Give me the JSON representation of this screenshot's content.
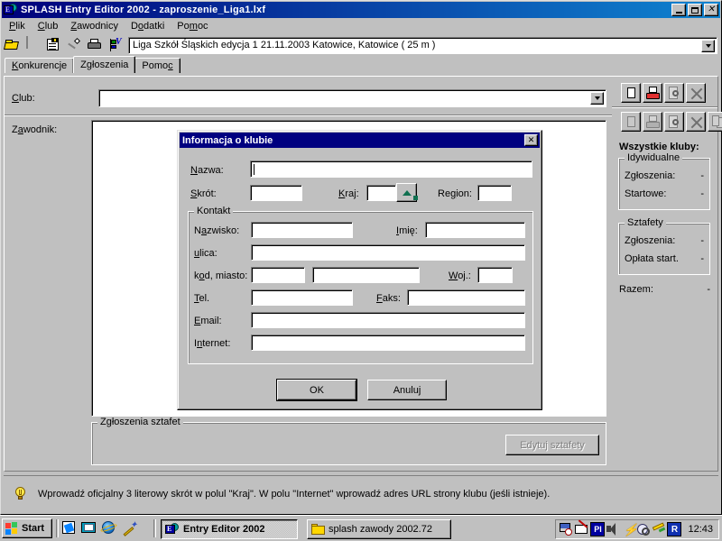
{
  "window": {
    "title": "SPLASH Entry Editor 2002 - zaproszenie_Liga1.lxf",
    "app_icon": "splash-app-icon",
    "minimize": "_",
    "maximize": "□",
    "close": "✕"
  },
  "menu": {
    "items": [
      {
        "label": "Plik",
        "accel": "P"
      },
      {
        "label": "Club",
        "accel": "C"
      },
      {
        "label": "Zawodnicy",
        "accel": "Z"
      },
      {
        "label": "Dodatki",
        "accel": "o"
      },
      {
        "label": "Pomoc",
        "accel": "m"
      }
    ]
  },
  "toolbar": {
    "buttons": [
      {
        "name": "open-icon",
        "title": "Otwórz"
      },
      {
        "name": "save-icon",
        "title": "Zapisz"
      },
      {
        "name": "properties-icon",
        "title": "Właściwości"
      },
      {
        "name": "pin-icon",
        "title": "Przypnij"
      },
      {
        "name": "print-icon",
        "title": "Drukuj"
      },
      {
        "name": "verify-flag-icon",
        "title": "Weryfikacja"
      }
    ],
    "meet_combo": {
      "value": "Liga Szkół Śląskich edycja 1      21.11.2003 Katowice,  Katowice   ( 25 m )",
      "arrow": "chevron-down-icon"
    }
  },
  "tabs": [
    {
      "label": "Konkurencje",
      "accel": "K",
      "active": false
    },
    {
      "label": "Zgłoszenia",
      "accel": "g",
      "active": true
    },
    {
      "label": "Pomoc",
      "accel": "c",
      "active": false
    }
  ],
  "main": {
    "club_label": "Club:",
    "club_accel": "C",
    "club_value": "",
    "zawodnik_label": "Zawodnik:",
    "zawodnik_accel": "a",
    "relay_group_title": "Zgłoszenia sztafet",
    "edit_relay_button": "Edytuj sztafety",
    "edit_relay_accel": "d"
  },
  "side_panel": {
    "row1_buttons": [
      {
        "name": "new-entry-icon",
        "enabled": true
      },
      {
        "name": "print-entry-icon",
        "enabled": true
      },
      {
        "name": "preview-entry-icon",
        "enabled": false
      },
      {
        "name": "delete-entry-icon",
        "enabled": true
      }
    ],
    "row2_buttons": [
      {
        "name": "new-athlete-icon",
        "enabled": false
      },
      {
        "name": "print-athlete-icon",
        "enabled": false
      },
      {
        "name": "preview-athlete-icon",
        "enabled": false
      },
      {
        "name": "delete-athlete-icon",
        "enabled": false
      },
      {
        "name": "copy-athlete-icon",
        "enabled": false
      }
    ],
    "title": "Wszystkie kluby:",
    "individual": {
      "title": "Idywidualne",
      "rows": [
        {
          "label": "Zgłoszenia:",
          "value": "-"
        },
        {
          "label": "Startowe:",
          "value": "-"
        }
      ]
    },
    "relays": {
      "title": "Sztafety",
      "rows": [
        {
          "label": "Zgłoszenia:",
          "value": "-"
        },
        {
          "label": "Opłata start.",
          "value": "-"
        }
      ]
    },
    "total": {
      "label": "Razem:",
      "value": "-"
    }
  },
  "hint_bar": {
    "icon": "lightbulb-icon",
    "text": "Wprowadź oficjalny 3 literowy skrót w polul \"Kraj\". W polu \"Internet\" wprowadź adres URL strony klubu (jeśli istnieje)."
  },
  "dialog": {
    "title": "Informacja o klubie",
    "close_label": "✕",
    "fields": {
      "nazwa": {
        "label": "Nazwa:",
        "accel": "a",
        "value": ""
      },
      "skrot": {
        "label": "Skrót:",
        "accel": "S",
        "value": ""
      },
      "kraj": {
        "label": "Kraj:",
        "accel": "K",
        "value": "",
        "button": "up-arrow-icon"
      },
      "region": {
        "label": "Region:",
        "accel": "g",
        "value": ""
      }
    },
    "kontakt": {
      "title": "Kontakt",
      "nazwisko": {
        "label": "Nazwisko:",
        "accel": "a",
        "value": ""
      },
      "imie": {
        "label": "Imię:",
        "accel": "I",
        "value": ""
      },
      "ulica": {
        "label": "ulica:",
        "accel": "u",
        "value": ""
      },
      "kod_miasto": {
        "label": "kod, miasto:",
        "accel": "o",
        "kod": "",
        "miasto": ""
      },
      "woj": {
        "label": "Woj.:",
        "accel": "W",
        "value": ""
      },
      "tel": {
        "label": "Tel.",
        "accel": "T",
        "value": ""
      },
      "faks": {
        "label": "Faks:",
        "accel": "F",
        "value": ""
      },
      "email": {
        "label": "Email:",
        "accel": "E",
        "value": ""
      },
      "internet": {
        "label": "Internet:",
        "accel": "n",
        "value": ""
      }
    },
    "ok_button": "OK",
    "cancel_button": "Anuluj"
  },
  "taskbar": {
    "start_label": "Start",
    "quick_launch": [
      {
        "name": "show-desktop-icon"
      },
      {
        "name": "mail-icon"
      },
      {
        "name": "internet-explorer-icon"
      },
      {
        "name": "wand-icon"
      }
    ],
    "tasks": [
      {
        "label": "Entry Editor 2002",
        "icon": "splash-app-icon",
        "active": true
      },
      {
        "label": "splash zawody 2002.72",
        "icon": "folder-icon",
        "active": false
      }
    ],
    "tray": [
      {
        "name": "scheduler-icon"
      },
      {
        "name": "mail-notify-icon"
      },
      {
        "name": "language-indicator-icon",
        "label": "Pl"
      },
      {
        "name": "volume-icon"
      },
      {
        "name": "power-bolt-icon"
      },
      {
        "name": "search-globe-icon"
      },
      {
        "name": "key-tool-icon"
      },
      {
        "name": "registry-icon",
        "label": "R"
      }
    ],
    "clock": "12:43"
  },
  "colors": {
    "face": "#c0c0c0",
    "desktop": "#008080",
    "title_active": "#000080",
    "window_white": "#ffffff",
    "shadow": "#808080",
    "disabled_text": "#808080"
  }
}
